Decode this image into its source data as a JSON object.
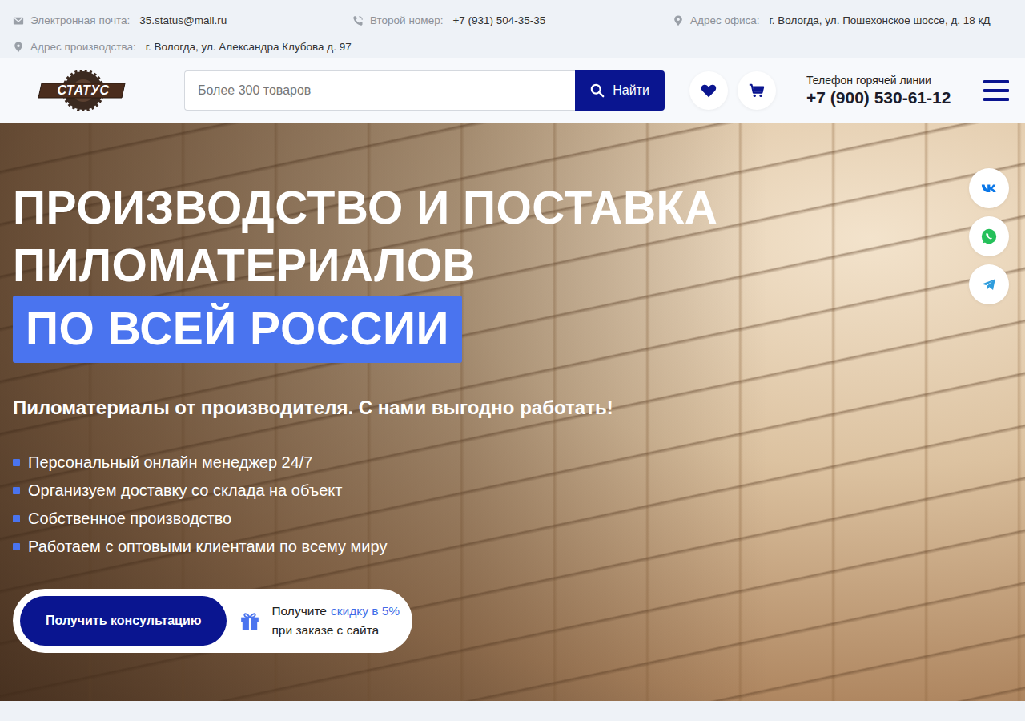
{
  "topbar": {
    "items": [
      {
        "kind": "email",
        "label": "Электронная почта:",
        "value": "35.status@mail.ru"
      },
      {
        "kind": "phone",
        "label": "Второй номер:",
        "value": "+7 (931) 504-35-35"
      },
      {
        "kind": "pin",
        "label": "Адрес офиса:",
        "value": "г. Вологда, ул. Пошехонское шоссе, д. 18 кД"
      },
      {
        "kind": "pin",
        "label": "Адрес производства:",
        "value": "г. Вологда, ул. Александра Клубова д. 97"
      }
    ]
  },
  "header": {
    "logo": "СТАТУС",
    "search": {
      "placeholder": "Более 300 товаров",
      "button": "Найти"
    },
    "hotline": {
      "label": "Телефон горячей линии",
      "phone": "+7 (900) 530-61-12"
    }
  },
  "hero": {
    "title": [
      "ПРОИЗВОДСТВО И ПОСТАВКА",
      "ПИЛОМАТЕРИАЛОВ"
    ],
    "title_highlight": "ПО ВСЕЙ РОССИИ",
    "subtitle": "Пиломатериалы от производителя. С нами выгодно работать!",
    "bullets": [
      "Персональный онлайн менеджер 24/7",
      "Организуем доставку со склада на объект",
      "Собственное производство",
      "Работаем с оптовыми клиентами по всему миру"
    ],
    "cta": {
      "button": "Получить консультацию",
      "note_before": "Получите",
      "note_link": "скидку в 5%",
      "note_after": "при заказе с сайта"
    }
  }
}
